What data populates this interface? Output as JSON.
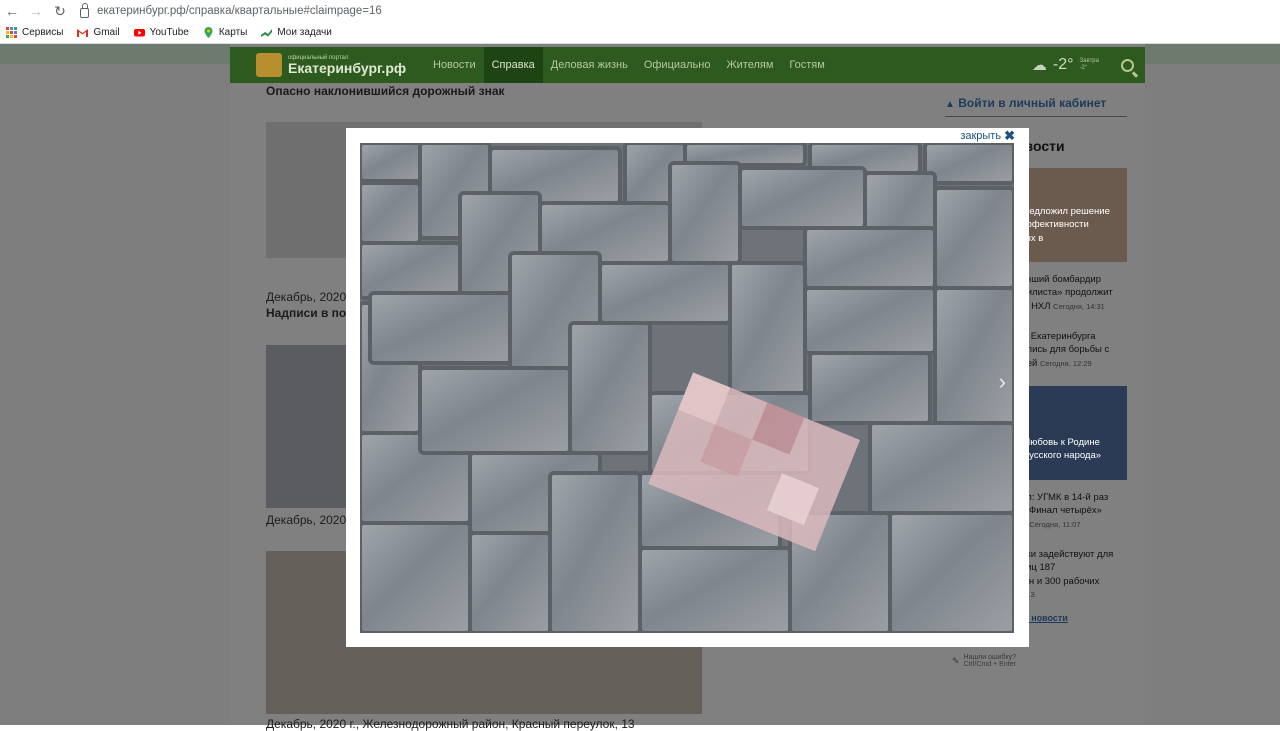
{
  "browser": {
    "url": "екатеринбург.рф/справка/квартальные#claimpage=16",
    "bookmarks": [
      {
        "label": "Сервисы",
        "icon": "apps-grid-icon",
        "color": "#4285f4"
      },
      {
        "label": "Gmail",
        "icon": "gmail-icon",
        "color": "#d93025"
      },
      {
        "label": "YouTube",
        "icon": "youtube-icon",
        "color": "#ff0000"
      },
      {
        "label": "Карты",
        "icon": "maps-pin-icon",
        "color": "#34a853"
      },
      {
        "label": "Мои задачи",
        "icon": "tasks-icon",
        "color": "#1e8e3e"
      }
    ]
  },
  "site": {
    "logo_sub": "официальный портал",
    "logo_main": "Екатеринбург.рф",
    "menu": [
      "Новости",
      "Справка",
      "Деловая жизнь",
      "Официально",
      "Жителям",
      "Гостям"
    ],
    "active_menu": "Справка",
    "weather_temp": "-2°",
    "tomorrow_label": "Завтра",
    "tomorrow_temp": "-2°"
  },
  "main": {
    "article_title": "Опасно наклонившийся дорожный знак",
    "caption1_date": "Декабрь, 2020",
    "caption1_title": "Надписи в под",
    "caption2_date": "Декабрь, 2020",
    "caption3": "Декабрь, 2020 г., Железнодорожный район, Красный переулок, 13"
  },
  "sidebar": {
    "login_link": "Войти в личный кабинет",
    "news_heading": "овости",
    "news": [
      {
        "text": "редложил решение",
        "text2": "ффективности",
        "text3": "ых в",
        "time": ""
      },
      {
        "text": "лучший бомбардир",
        "text2": "обилиста» продолжит",
        "text3": "у в НХЛ",
        "time": "Сегодня, 14:31"
      },
      {
        "text": "ры Екатеринбурга",
        "text2": "нились для борьбы с",
        "text3": "цией",
        "time": "Сегодня, 12:29"
      },
      {
        "text": "Любовь к Родине",
        "text2": "русского народа»",
        "text3": "",
        "time": ""
      },
      {
        "text": "пол: УГМК в 14-й раз",
        "text2": "в «Финал четырёх»",
        "text3": "Ти",
        "time": "Сегодня, 11:07"
      },
      {
        "text": "ники задействуют для",
        "text2": "улиц 187",
        "text3": "шин и 300 рабочих",
        "time": "10:13"
      }
    ],
    "all_news": "ые новости",
    "error_note_1": "Нашли ошибку?",
    "error_note_2": "Ctrl/Cmd + Enter"
  },
  "modal": {
    "close_label": "закрыть",
    "next_arrow": "›"
  }
}
